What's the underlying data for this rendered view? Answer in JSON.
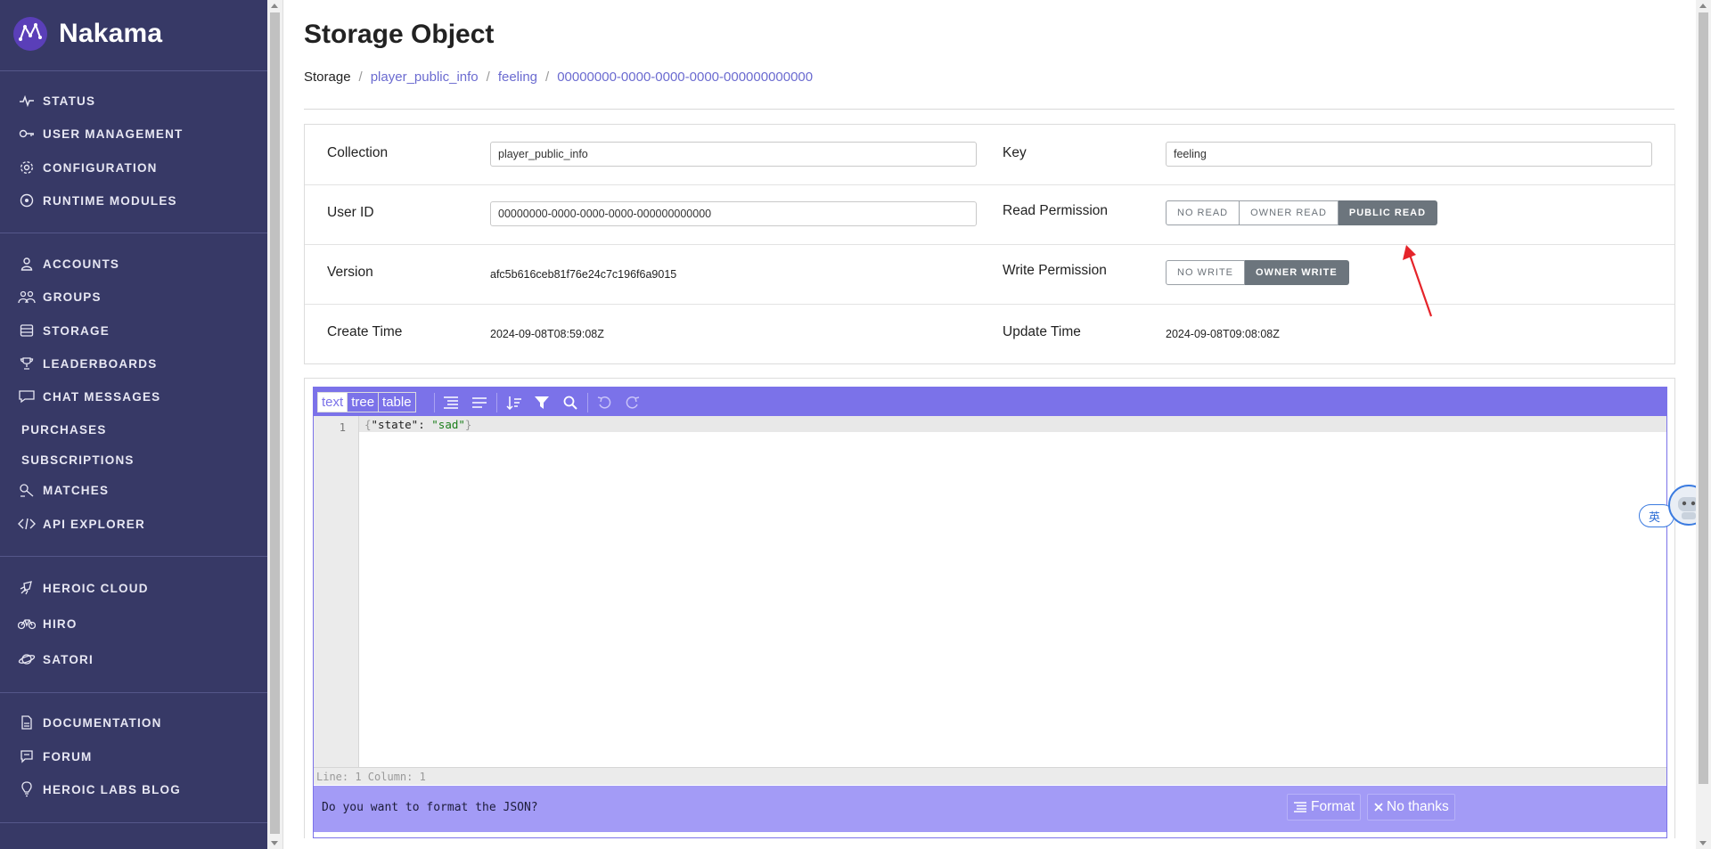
{
  "app": {
    "name": "Nakama"
  },
  "sidebar": {
    "items": [
      {
        "label": "STATUS",
        "icon": "pulse-icon"
      },
      {
        "label": "USER MANAGEMENT",
        "icon": "key-icon"
      },
      {
        "label": "CONFIGURATION",
        "icon": "gear-icon"
      },
      {
        "label": "RUNTIME MODULES",
        "icon": "module-icon"
      },
      {
        "label": "ACCOUNTS",
        "icon": "user-icon"
      },
      {
        "label": "GROUPS",
        "icon": "groups-icon"
      },
      {
        "label": "STORAGE",
        "icon": "storage-icon"
      },
      {
        "label": "LEADERBOARDS",
        "icon": "trophy-icon"
      },
      {
        "label": "CHAT MESSAGES",
        "icon": "chat-icon"
      },
      {
        "label": "PURCHASES",
        "icon": ""
      },
      {
        "label": "SUBSCRIPTIONS",
        "icon": ""
      },
      {
        "label": "MATCHES",
        "icon": "matches-icon"
      },
      {
        "label": "API EXPLORER",
        "icon": "code-icon"
      },
      {
        "label": "HEROIC CLOUD",
        "icon": "rocket-icon"
      },
      {
        "label": "HIRO",
        "icon": "bike-icon"
      },
      {
        "label": "SATORI",
        "icon": "planet-icon"
      },
      {
        "label": "DOCUMENTATION",
        "icon": "document-icon"
      },
      {
        "label": "FORUM",
        "icon": "forum-icon"
      },
      {
        "label": "HEROIC LABS BLOG",
        "icon": "bulb-icon"
      }
    ]
  },
  "page": {
    "title": "Storage Object",
    "breadcrumb": [
      "Storage",
      "player_public_info",
      "feeling",
      "00000000-0000-0000-0000-000000000000"
    ],
    "separator": "/"
  },
  "fields": {
    "collection_label": "Collection",
    "collection_value": "player_public_info",
    "key_label": "Key",
    "key_value": "feeling",
    "user_id_label": "User ID",
    "user_id_value": "00000000-0000-0000-0000-000000000000",
    "read_permission_label": "Read Permission",
    "read_options": [
      "NO READ",
      "OWNER READ",
      "PUBLIC READ"
    ],
    "read_selected": "PUBLIC READ",
    "version_label": "Version",
    "version_value": "afc5b616ceb81f76e24c7c196f6a9015",
    "write_permission_label": "Write Permission",
    "write_options": [
      "NO WRITE",
      "OWNER WRITE"
    ],
    "write_selected": "OWNER WRITE",
    "create_time_label": "Create Time",
    "create_time_value": "2024-09-08T08:59:08Z",
    "update_time_label": "Update Time",
    "update_time_value": "2024-09-08T09:08:08Z"
  },
  "editor": {
    "modes": [
      "text",
      "tree",
      "table"
    ],
    "active_mode": "text",
    "line_number": "1",
    "code": {
      "open": "{",
      "key": "\"state\"",
      "colon": ": ",
      "value": "\"sad\"",
      "close": "}"
    },
    "status": "Line: 1  Column: 1",
    "format_prompt": "Do you want to format the JSON?",
    "format_button": "Format",
    "no_thanks_button": "No thanks"
  },
  "widget": {
    "lang": "英"
  },
  "colors": {
    "sidebar": "#373966",
    "accent": "#7b72e9",
    "link": "#6b6bd0",
    "annotation": "#e5242a"
  }
}
